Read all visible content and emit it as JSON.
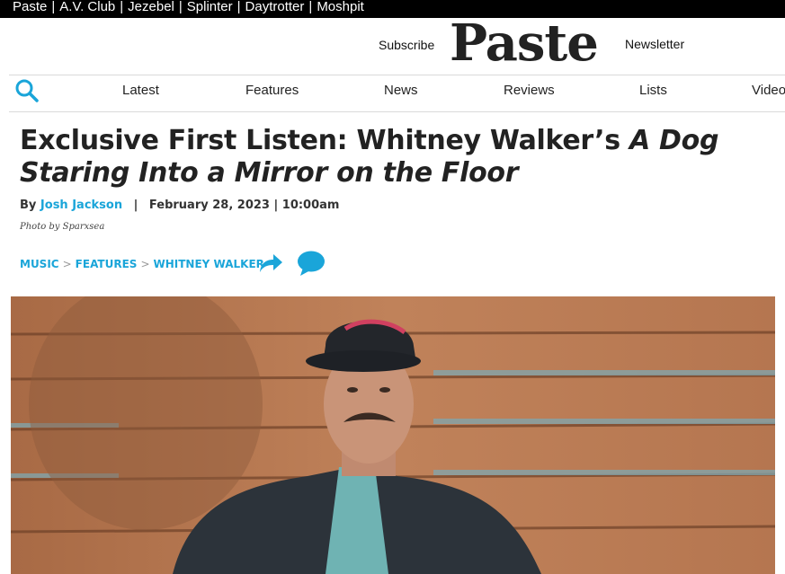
{
  "network": {
    "links": [
      "Paste",
      "A.V. Club",
      "Jezebel",
      "Splinter",
      "Daytrotter",
      "Moshpit"
    ],
    "separator": "|"
  },
  "masthead": {
    "subscribe_label": "Subscribe",
    "newsletter_label": "Newsletter",
    "logo_text": "Paste"
  },
  "nav": {
    "items": [
      "Latest",
      "Features",
      "News",
      "Reviews",
      "Lists",
      "Video"
    ]
  },
  "article": {
    "headline_plain": "Exclusive First Listen: Whitney Walker’s ",
    "headline_italic": "A Dog Staring Into a Mirror on the Floor",
    "by_label": "By",
    "author": "Josh Jackson",
    "byline_sep": "|",
    "date": "February 28, 2023 | 10:00am",
    "photo_credit": "Photo by Sparxsea",
    "breadcrumbs": [
      "MUSIC",
      "FEATURES",
      "WHITNEY WALKER"
    ],
    "breadcrumb_sep": ">"
  },
  "colors": {
    "accent": "#1aa5d9",
    "topbar_bg": "#000000"
  },
  "icons": [
    "search-icon",
    "share-icon",
    "comment-icon"
  ]
}
